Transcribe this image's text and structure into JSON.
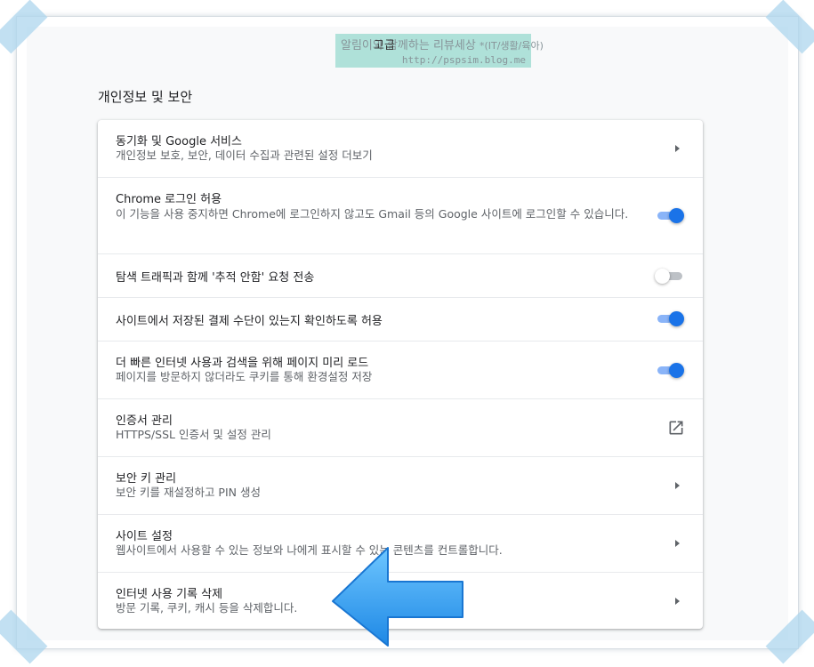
{
  "watermark": {
    "line1": "알림이와 함께하는 리뷰세상",
    "line1_sub": "*(IT/생활/육아)",
    "line2": "http://pspsim.blog.me",
    "overlay": "고급"
  },
  "section": {
    "title": "개인정보 및 보안"
  },
  "rows": [
    {
      "title": "동기화 및 Google 서비스",
      "sub": "개인정보 보호, 보안, 데이터 수집과 관련된 설정 더보기",
      "control": "chevron-right"
    },
    {
      "title": "Chrome 로그인 허용",
      "sub": "이 기능을 사용 중지하면 Chrome에 로그인하지 않고도 Gmail 등의 Google 사이트에 로그인할 수 있습니다.",
      "control": "toggle",
      "state": "on"
    },
    {
      "title": "탐색 트래픽과 함께 '추적 안함' 요청 전송",
      "sub": "",
      "control": "toggle",
      "state": "off"
    },
    {
      "title": "사이트에서 저장된 결제 수단이 있는지 확인하도록 허용",
      "sub": "",
      "control": "toggle",
      "state": "on"
    },
    {
      "title": "더 빠른 인터넷 사용과 검색을 위해 페이지 미리 로드",
      "sub": "페이지를 방문하지 않더라도 쿠키를 통해 환경설정 저장",
      "control": "toggle",
      "state": "on"
    },
    {
      "title": "인증서 관리",
      "sub": "HTTPS/SSL 인증서 및 설정 관리",
      "control": "open-in-new"
    },
    {
      "title": "보안 키 관리",
      "sub": "보안 키를 재설정하고 PIN 생성",
      "control": "chevron-right"
    },
    {
      "title": "사이트 설정",
      "sub": "웹사이트에서 사용할 수 있는 정보와 나에게 표시할 수 있는 콘텐츠를 컨트롤합니다.",
      "control": "chevron-right"
    },
    {
      "title": "인터넷 사용 기록 삭제",
      "sub": "방문 기록, 쿠키, 캐시 등을 삭제합니다.",
      "control": "chevron-right"
    }
  ],
  "colors": {
    "accent": "#1a73e8",
    "accent_track": "#8ab4f8",
    "annotation_arrow": "#2196f3"
  }
}
